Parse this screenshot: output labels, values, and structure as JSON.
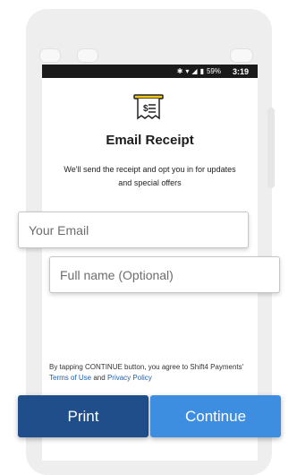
{
  "status_bar": {
    "battery": "59%",
    "time": "3:19"
  },
  "header": {
    "icon": "receipt-icon",
    "title": "Email Receipt",
    "subtitle": "We'll send the receipt and opt you in for updates and special offers"
  },
  "form": {
    "email_placeholder": "Your Email",
    "email_value": "",
    "name_placeholder": "Full name (Optional)",
    "name_value": ""
  },
  "legal": {
    "prefix": "By tapping CONTINUE button, you agree to Shift4 Payments'",
    "terms_link": "Terms of Use",
    "and": "and",
    "privacy_link": "Privacy Policy"
  },
  "actions": {
    "print_label": "Print",
    "continue_label": "Continue"
  },
  "colors": {
    "print_button": "#1f4e8a",
    "continue_button": "#3d8de0",
    "link": "#2460a8"
  }
}
